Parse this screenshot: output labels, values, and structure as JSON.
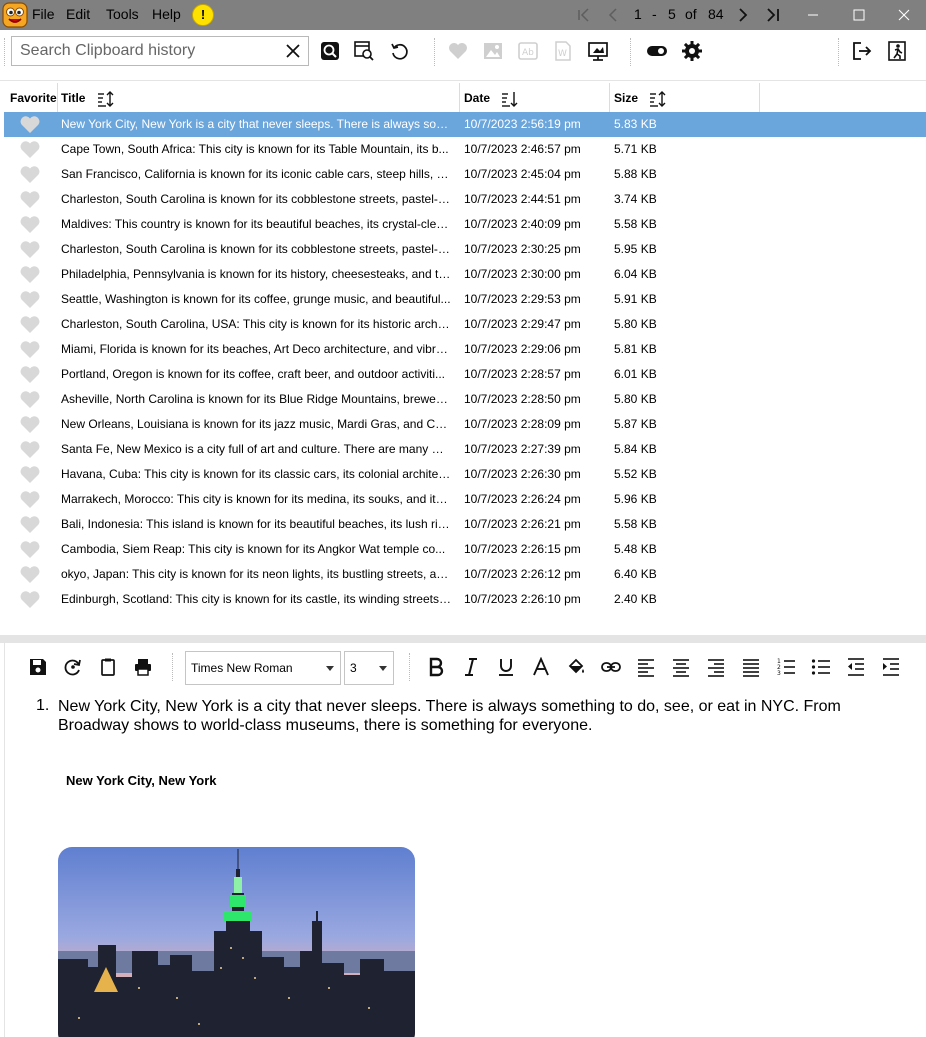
{
  "menu": {
    "file": "File",
    "edit": "Edit",
    "tools": "Tools",
    "help": "Help",
    "alert": "!"
  },
  "pagination": {
    "start": "1",
    "dash": "-",
    "end": "5",
    "of": "of",
    "total": "84"
  },
  "search": {
    "placeholder": "Search Clipboard history",
    "value": ""
  },
  "table": {
    "headers": {
      "favorite": "Favorite",
      "title": "Title",
      "date": "Date",
      "size": "Size"
    },
    "rows": [
      {
        "title": "New York City, New York is a city that never sleeps. There is always som...",
        "date": "10/7/2023 2:56:19 pm",
        "size": "5.83 KB",
        "selected": true
      },
      {
        "title": "Cape Town, South Africa: This city is known for its Table Mountain, its b...",
        "date": "10/7/2023 2:46:57 pm",
        "size": "5.71 KB"
      },
      {
        "title": "San Francisco, California is known for its iconic cable cars, steep hills, an...",
        "date": "10/7/2023 2:45:04 pm",
        "size": "5.88 KB"
      },
      {
        "title": "Charleston, South Carolina is known for its cobblestone streets, pastel-c...",
        "date": "10/7/2023 2:44:51 pm",
        "size": "3.74 KB"
      },
      {
        "title": "Maldives: This country is known for its beautiful beaches, its crystal-clea...",
        "date": "10/7/2023 2:40:09 pm",
        "size": "5.58 KB"
      },
      {
        "title": "Charleston, South Carolina is known for its cobblestone streets, pastel-c...",
        "date": "10/7/2023 2:30:25 pm",
        "size": "5.95 KB"
      },
      {
        "title": "Philadelphia, Pennsylvania is known for its history, cheesesteaks, and th...",
        "date": "10/7/2023 2:30:00 pm",
        "size": "6.04 KB"
      },
      {
        "title": "Seattle, Washington is known for its coffee, grunge music, and beautiful...",
        "date": "10/7/2023 2:29:53 pm",
        "size": "5.91 KB"
      },
      {
        "title": "Charleston, South Carolina, USA: This city is known for its historic archit...",
        "date": "10/7/2023 2:29:47 pm",
        "size": "5.80 KB"
      },
      {
        "title": "Miami, Florida is known for its beaches, Art Deco architecture, and vibra...",
        "date": "10/7/2023 2:29:06 pm",
        "size": "5.81 KB"
      },
      {
        "title": "Portland, Oregon is known for its coffee, craft beer, and outdoor activiti...",
        "date": "10/7/2023 2:28:57 pm",
        "size": "6.01 KB"
      },
      {
        "title": "Asheville, North Carolina is known for its Blue Ridge Mountains, breweri...",
        "date": "10/7/2023 2:28:50 pm",
        "size": "5.80 KB"
      },
      {
        "title": "New Orleans, Louisiana is known for its jazz music, Mardi Gras, and Cre...",
        "date": "10/7/2023 2:28:09 pm",
        "size": "5.87 KB"
      },
      {
        "title": "Santa Fe, New Mexico is a city full of art and culture. There are many m...",
        "date": "10/7/2023 2:27:39 pm",
        "size": "5.84 KB"
      },
      {
        "title": "Havana, Cuba: This city is known for its classic cars, its colonial architect...",
        "date": "10/7/2023 2:26:30 pm",
        "size": "5.52 KB"
      },
      {
        "title": "Marrakech, Morocco: This city is known for its medina, its souks, and its...",
        "date": "10/7/2023 2:26:24 pm",
        "size": "5.96 KB"
      },
      {
        "title": "Bali, Indonesia: This island is known for its beautiful beaches, its lush ric...",
        "date": "10/7/2023 2:26:21 pm",
        "size": "5.58 KB"
      },
      {
        "title": "Cambodia, Siem Reap: This city is known for its Angkor Wat temple co...",
        "date": "10/7/2023 2:26:15 pm",
        "size": "5.48 KB"
      },
      {
        "title": "okyo, Japan: This city is known for its neon lights, its bustling streets, an...",
        "date": "10/7/2023 2:26:12 pm",
        "size": "6.40 KB"
      },
      {
        "title": "Edinburgh, Scotland: This city is known for its castle, its winding streets,...",
        "date": "10/7/2023 2:26:10 pm",
        "size": "2.40 KB"
      }
    ]
  },
  "editor": {
    "font_family": "Times New Roman",
    "font_size": "3",
    "list_number": "1.",
    "paragraph": "New York City, New York is a city that never sleeps. There is always something to do, see, or eat in NYC. From Broadway shows to world-class museums, there is something for everyone.",
    "caption": "New York City, New York"
  },
  "colors": {
    "titlebar": "#808080",
    "selection": "#6aa5dc",
    "heart": "#d8d8d8",
    "alert": "#ffe100"
  }
}
